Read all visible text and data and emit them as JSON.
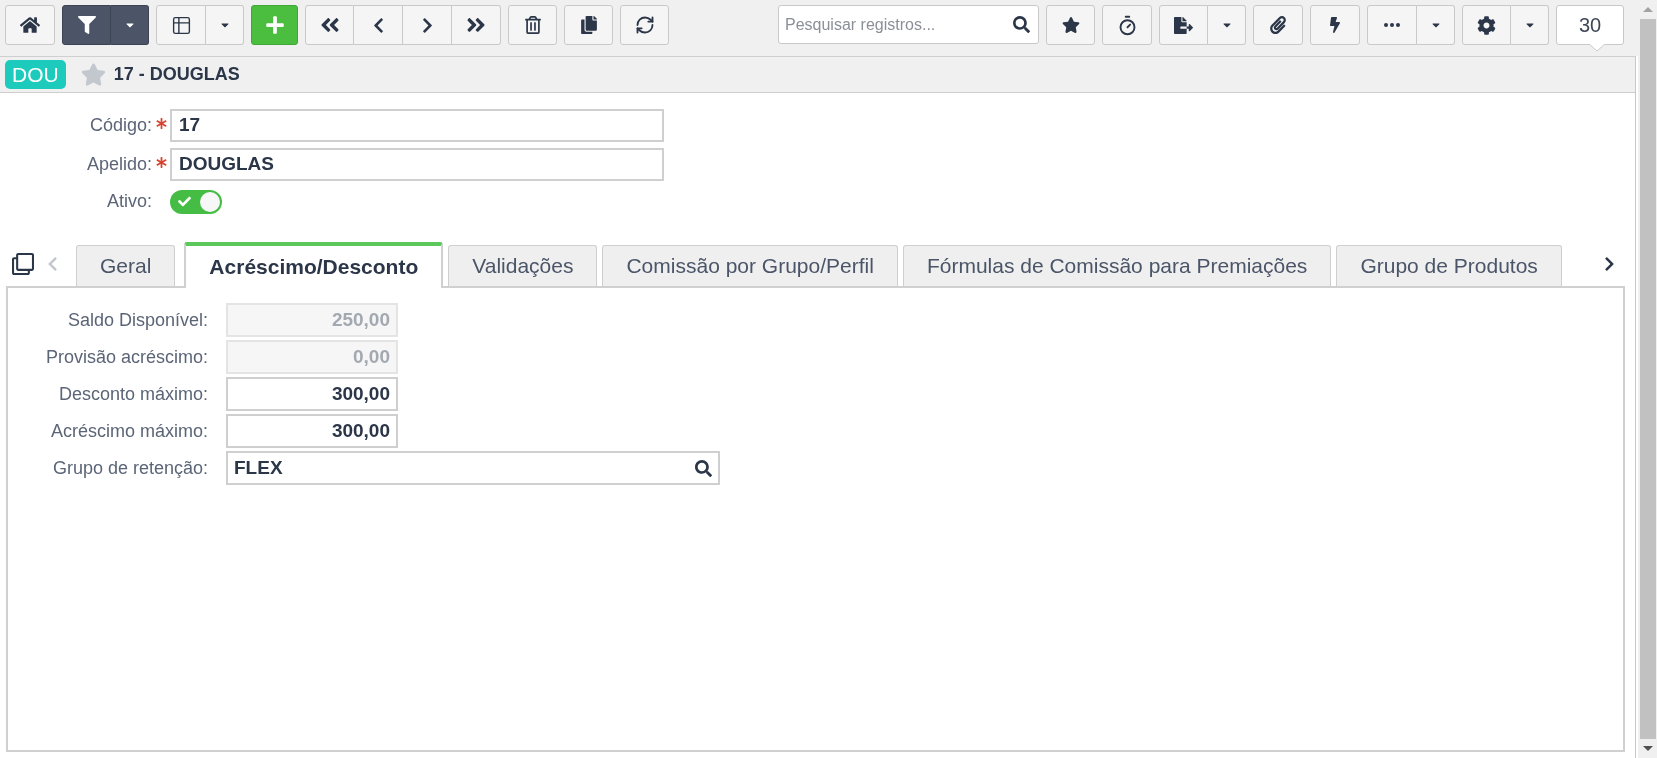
{
  "toolbar": {
    "filter_active": true,
    "search": {
      "placeholder": "Pesquisar registros..."
    },
    "page_size": "30"
  },
  "record_header": {
    "badge": "DOU",
    "favorite": false,
    "title": "17 - DOUGLAS"
  },
  "form": {
    "fields": [
      {
        "label": "Código:",
        "required": true,
        "value": "17"
      },
      {
        "label": "Apelido:",
        "required": true,
        "value": "DOUGLAS"
      }
    ],
    "active": {
      "label": "Ativo:",
      "on": true
    }
  },
  "tabs": {
    "scroll_left_disabled": true,
    "scroll_right_disabled": false,
    "items": [
      {
        "label": "Geral",
        "selected": false
      },
      {
        "label": "Acréscimo/Desconto",
        "selected": true
      },
      {
        "label": "Validações",
        "selected": false
      },
      {
        "label": "Comissão por Grupo/Perfil",
        "selected": false
      },
      {
        "label": "Fórmulas de Comissão para Premiações",
        "selected": false
      },
      {
        "label": "Grupo de Produtos",
        "selected": false
      }
    ]
  },
  "tab_panel": {
    "fields": [
      {
        "kind": "number",
        "label": "Saldo Disponível:",
        "value": "250,00",
        "disabled": true
      },
      {
        "kind": "number",
        "label": "Provisão acréscimo:",
        "value": "0,00",
        "disabled": true
      },
      {
        "kind": "number",
        "label": "Desconto máximo:",
        "value": "300,00",
        "disabled": false
      },
      {
        "kind": "number",
        "label": "Acréscimo máximo:",
        "value": "300,00",
        "disabled": false
      },
      {
        "kind": "lookup",
        "label": "Grupo de retenção:",
        "value": "FLEX",
        "disabled": false
      }
    ]
  }
}
